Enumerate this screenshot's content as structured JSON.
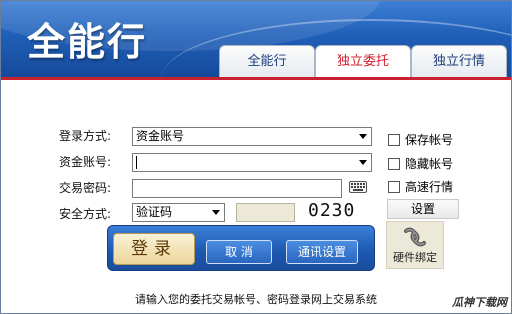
{
  "header": {
    "app_title": "全能行",
    "tabs": [
      {
        "label": "全能行",
        "active": false
      },
      {
        "label": "独立委托",
        "active": true
      },
      {
        "label": "独立行情",
        "active": false
      }
    ]
  },
  "form": {
    "login_method": {
      "label": "登录方式:",
      "value": "资金账号"
    },
    "account": {
      "label": "资金账号:",
      "value": ""
    },
    "trade_password": {
      "label": "交易密码:",
      "value": ""
    },
    "security_method": {
      "label": "安全方式:",
      "value": "验证码",
      "captcha": "0230"
    }
  },
  "options": {
    "save_account": "保存帐号",
    "hide_account": "隐藏帐号",
    "fast_quote": "高速行情",
    "settings": "设置"
  },
  "actions": {
    "login": "登录",
    "cancel": "取 消",
    "comm_settings": "通讯设置",
    "hardware_bind": "硬件绑定"
  },
  "footer": {
    "hint": "请输入您的委托交易帐号、密码登录网上交易系统",
    "watermark": "瓜神下载网"
  },
  "colors": {
    "header_blue": "#1f5fb8",
    "accent_red": "#c8202f",
    "active_tab_text": "#d21f2f"
  },
  "icons": [
    "keyboard-icon",
    "dropdown-arrow-icon",
    "chain-link-icon"
  ]
}
